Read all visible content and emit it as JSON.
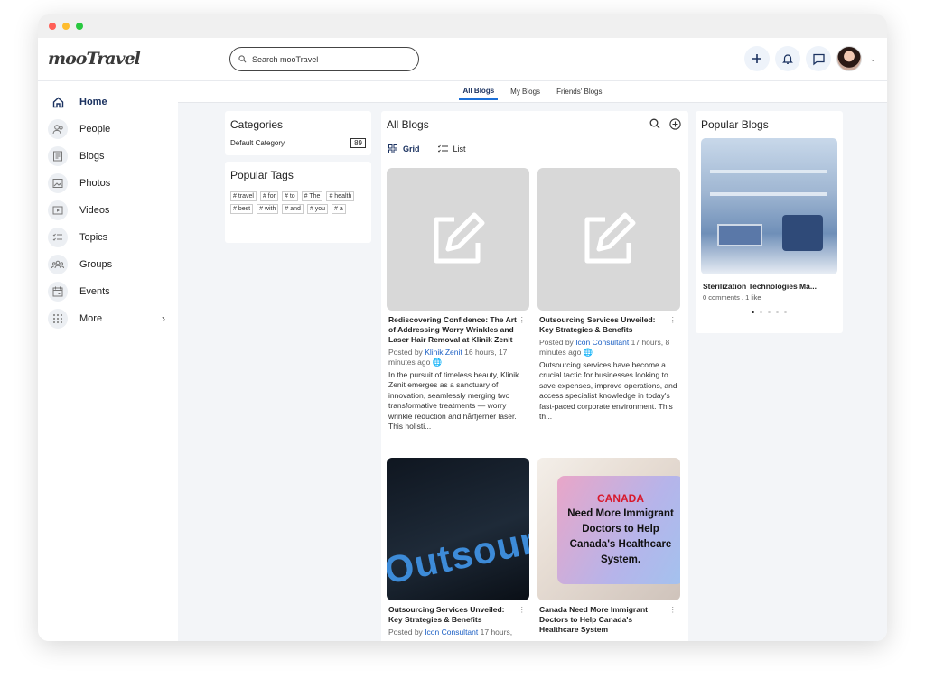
{
  "app": {
    "logo": "mooTravel"
  },
  "search": {
    "placeholder": "Search mooTravel"
  },
  "sidebar": {
    "items": [
      {
        "label": "Home",
        "icon": "home-icon",
        "active": true
      },
      {
        "label": "People",
        "icon": "people-icon"
      },
      {
        "label": "Blogs",
        "icon": "blogs-icon"
      },
      {
        "label": "Photos",
        "icon": "photos-icon"
      },
      {
        "label": "Videos",
        "icon": "videos-icon"
      },
      {
        "label": "Topics",
        "icon": "topics-icon"
      },
      {
        "label": "Groups",
        "icon": "groups-icon"
      },
      {
        "label": "Events",
        "icon": "events-icon"
      },
      {
        "label": "More",
        "icon": "more-icon"
      }
    ]
  },
  "subtabs": [
    "All Blogs",
    "My Blogs",
    "Friends' Blogs"
  ],
  "categories": {
    "title": "Categories",
    "items": [
      {
        "name": "Default Category",
        "count": "89"
      }
    ]
  },
  "popular_tags": {
    "title": "Popular Tags",
    "tags": [
      "# travel",
      "# for",
      "# to",
      "# The",
      "# health",
      "# best",
      "# with",
      "# and",
      "# you",
      "# a"
    ]
  },
  "blogs": {
    "title": "All Blogs",
    "view_grid": "Grid",
    "view_list": "List",
    "posts": [
      {
        "title": "Rediscovering Confidence: The Art of Addressing Worry Wrinkles and Laser Hair Removal at Klinik Zenit",
        "posted_by": "Posted by",
        "author": "Klinik Zenit",
        "time": "16 hours, 17 minutes ago",
        "excerpt": "In the pursuit of timeless beauty, Klinik Zenit emerges as a sanctuary of innovation, seamlessly merging two transformative treatments — worry wrinkle reduction and hårfjerner laser. This holisti..."
      },
      {
        "title": "Outsourcing Services Unveiled: Key Strategies & Benefits",
        "posted_by": "Posted by",
        "author": "Icon Consultant",
        "time": "17 hours, 8 minutes ago",
        "excerpt": "Outsourcing services have become a crucial tactic for businesses looking to save expenses, improve operations, and access specialist knowledge in today's fast-paced corporate environment. This th..."
      },
      {
        "title": "Outsourcing Services Unveiled: Key Strategies & Benefits",
        "posted_by": "Posted by",
        "author": "Icon Consultant",
        "time": "17 hours,",
        "image_text": "Outsourc"
      },
      {
        "title": "Canada Need More Immigrant Doctors to Help Canada's Healthcare System",
        "image_text_red": "CANADA",
        "image_text": "Need More Immigrant Doctors to Help Canada's Healthcare System."
      }
    ]
  },
  "popular_blogs": {
    "title": "Popular Blogs",
    "items": [
      {
        "title": "Sterilization Technologies Ma...",
        "meta": "0 comments . 1 like"
      }
    ],
    "active_slide": 1,
    "slides": 5
  },
  "colors": {
    "accent": "#1b6fd8",
    "nav_active": "#1b3260",
    "link": "#1b5fc4"
  }
}
